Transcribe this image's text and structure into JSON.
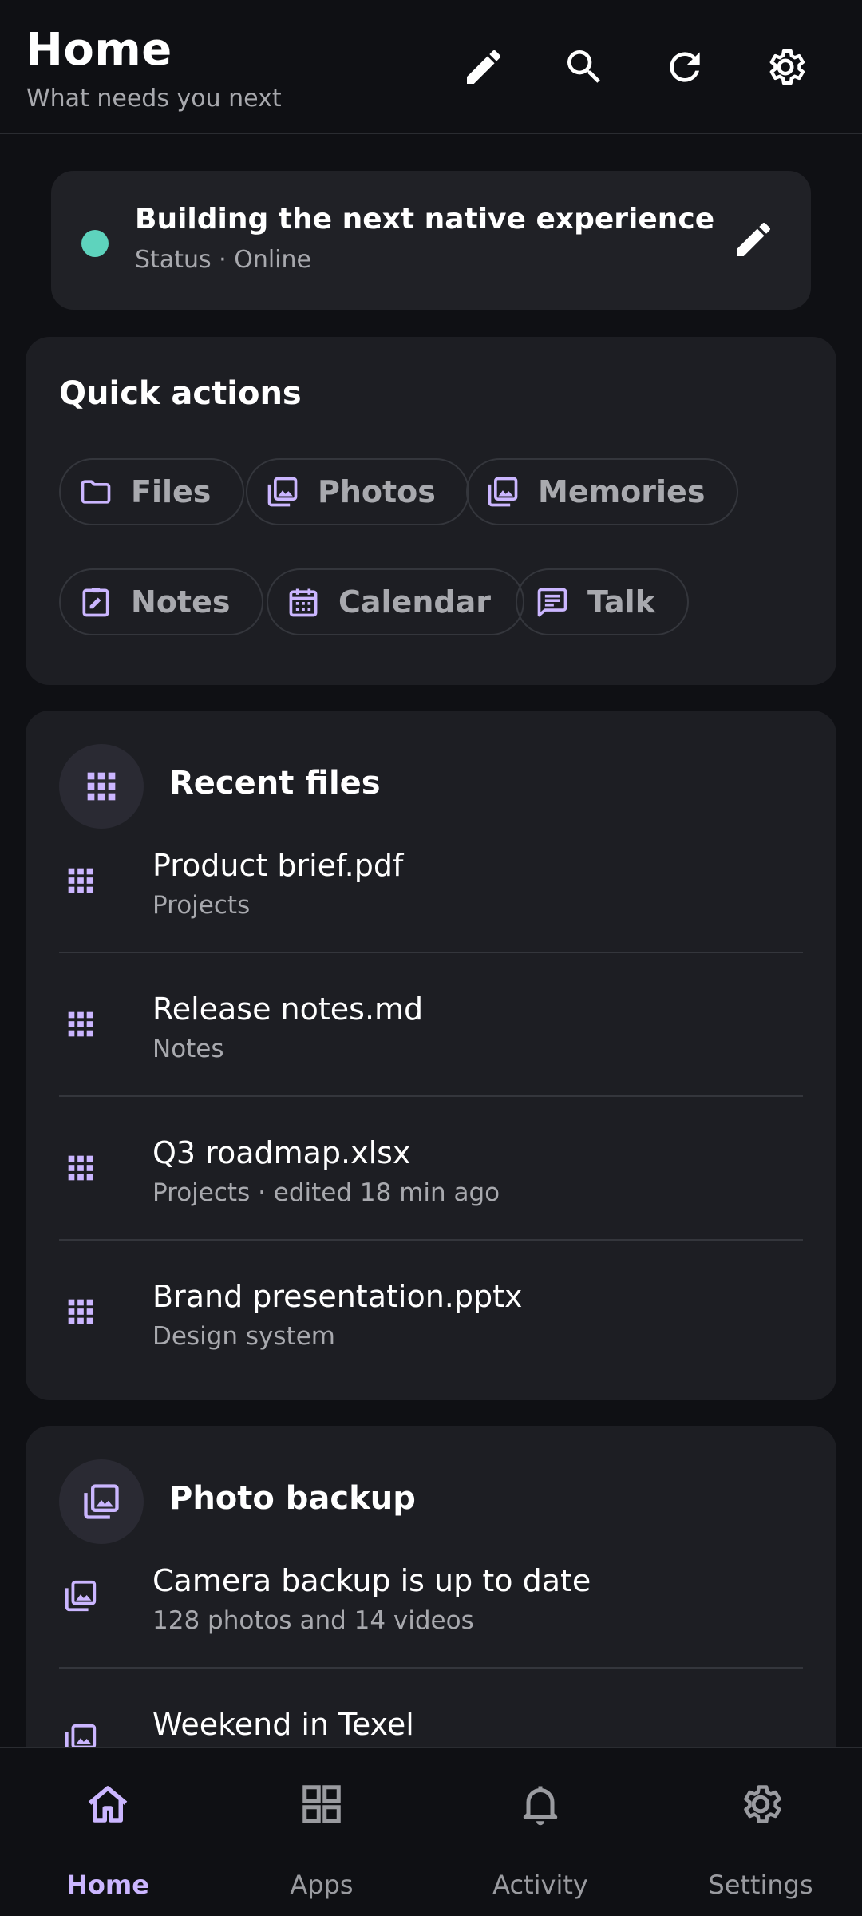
{
  "header": {
    "title": "Home",
    "subtitle": "What needs you next",
    "actions": [
      "edit-icon",
      "search-icon",
      "refresh-icon",
      "settings-icon"
    ]
  },
  "status": {
    "title": "Building the next native experience",
    "subtitle": "Status · Online",
    "dot_color": "#5ed3bd"
  },
  "quick_actions": {
    "title": "Quick actions",
    "chips": [
      {
        "label": "Files",
        "icon": "folder-icon"
      },
      {
        "label": "Photos",
        "icon": "photos-icon"
      },
      {
        "label": "Memories",
        "icon": "memories-icon"
      },
      {
        "label": "Notes",
        "icon": "notes-icon"
      },
      {
        "label": "Calendar",
        "icon": "calendar-icon"
      },
      {
        "label": "Talk",
        "icon": "chat-icon"
      }
    ]
  },
  "recent_files": {
    "title": "Recent files",
    "items": [
      {
        "name": "Product brief.pdf",
        "meta": "Projects"
      },
      {
        "name": "Release notes.md",
        "meta": "Notes"
      },
      {
        "name": "Q3 roadmap.xlsx",
        "meta": "Projects · edited 18 min ago"
      },
      {
        "name": "Brand presentation.pptx",
        "meta": "Design system"
      }
    ]
  },
  "photo_backup": {
    "title": "Photo backup",
    "items": [
      {
        "name": "Camera backup is up to date",
        "meta": "128 photos and 14 videos"
      },
      {
        "name": "Weekend in Texel",
        "meta": ""
      }
    ]
  },
  "bottom_nav": [
    {
      "label": "Home",
      "icon": "home-icon",
      "active": true
    },
    {
      "label": "Apps",
      "icon": "apps-grid-icon",
      "active": false
    },
    {
      "label": "Activity",
      "icon": "bell-icon",
      "active": false
    },
    {
      "label": "Settings",
      "icon": "settings-icon",
      "active": false
    }
  ],
  "colors": {
    "accent": "#cbb6ff",
    "background": "#0f1014",
    "card": "#1d1e23"
  }
}
